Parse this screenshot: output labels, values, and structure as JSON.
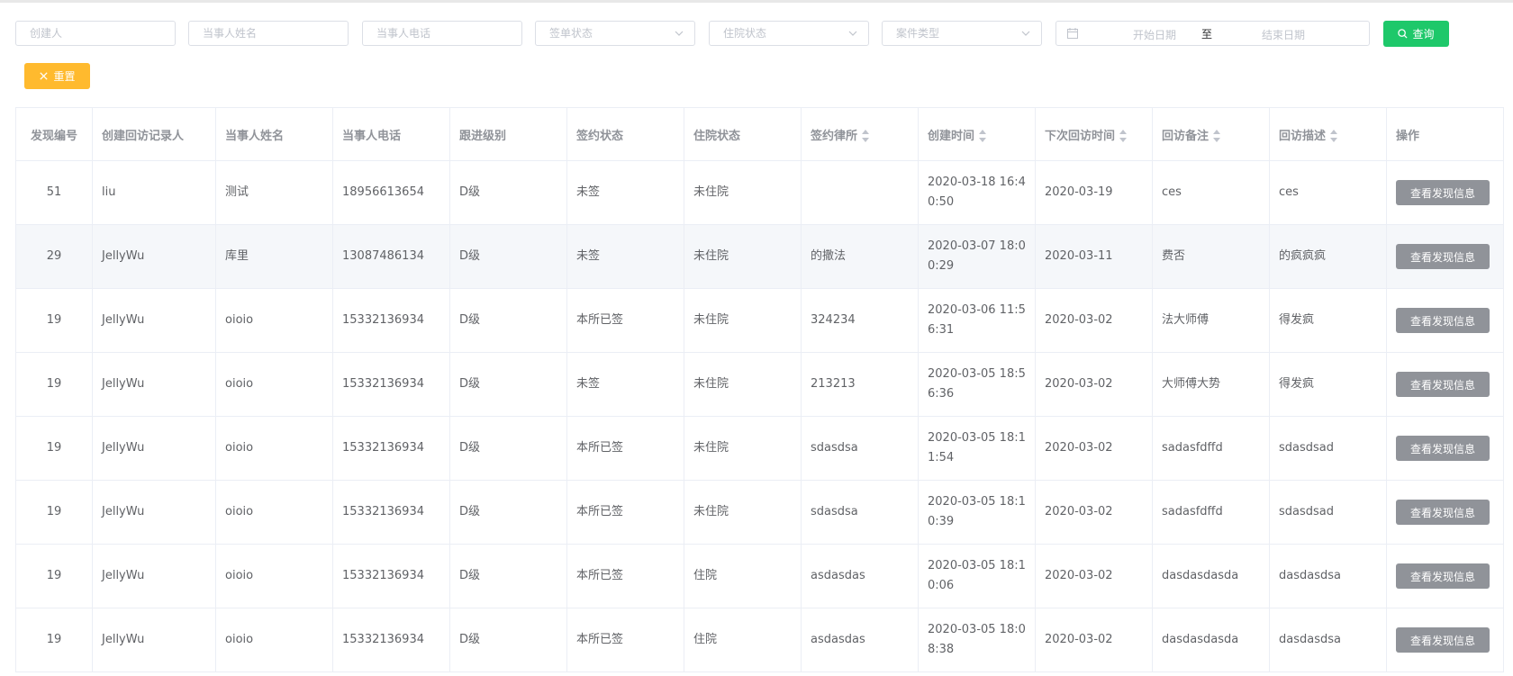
{
  "filters": {
    "creator_placeholder": "创建人",
    "party_name_placeholder": "当事人姓名",
    "party_phone_placeholder": "当事人电话",
    "sign_status_placeholder": "签单状态",
    "hospital_status_placeholder": "住院状态",
    "case_type_placeholder": "案件类型",
    "start_date_placeholder": "开始日期",
    "date_separator": "至",
    "end_date_placeholder": "结束日期",
    "query_label": "查询",
    "reset_label": "重置"
  },
  "table": {
    "headers": [
      "发现编号",
      "创建回访记录人",
      "当事人姓名",
      "当事人电话",
      "跟进级别",
      "签约状态",
      "住院状态",
      "签约律所",
      "创建时间",
      "下次回访时间",
      "回访备注",
      "回访描述",
      "操作"
    ],
    "action_label": "查看发现信息",
    "rows": [
      [
        "51",
        "liu",
        "测试",
        "18956613654",
        "D级",
        "未签",
        "未住院",
        "",
        "2020-03-18 16:40:50",
        "2020-03-19",
        "ces",
        "ces"
      ],
      [
        "29",
        "JellyWu",
        "库里",
        "13087486134",
        "D级",
        "未签",
        "未住院",
        "的撒法",
        "2020-03-07 18:00:29",
        "2020-03-11",
        "费否",
        "的疯疯疯"
      ],
      [
        "19",
        "JellyWu",
        "oioio",
        "15332136934",
        "D级",
        "本所已签",
        "未住院",
        "324234",
        "2020-03-06 11:56:31",
        "2020-03-02",
        "法大师傅",
        "得发疯"
      ],
      [
        "19",
        "JellyWu",
        "oioio",
        "15332136934",
        "D级",
        "未签",
        "未住院",
        "213213",
        "2020-03-05 18:56:36",
        "2020-03-02",
        "大师傅大势",
        "得发疯"
      ],
      [
        "19",
        "JellyWu",
        "oioio",
        "15332136934",
        "D级",
        "本所已签",
        "未住院",
        "sdasdsa",
        "2020-03-05 18:11:54",
        "2020-03-02",
        "sadasfdffd",
        "sdasdsad"
      ],
      [
        "19",
        "JellyWu",
        "oioio",
        "15332136934",
        "D级",
        "本所已签",
        "未住院",
        "sdasdsa",
        "2020-03-05 18:10:39",
        "2020-03-02",
        "sadasfdffd",
        "sdasdsad"
      ],
      [
        "19",
        "JellyWu",
        "oioio",
        "15332136934",
        "D级",
        "本所已签",
        "住院",
        "asdasdas",
        "2020-03-05 18:10:06",
        "2020-03-02",
        "dasdasdasda",
        "dasdasdsa"
      ],
      [
        "19",
        "JellyWu",
        "oioio",
        "15332136934",
        "D级",
        "本所已签",
        "住院",
        "asdasdas",
        "2020-03-05 18:08:38",
        "2020-03-02",
        "dasdasdasda",
        "dasdasdsa"
      ]
    ]
  },
  "colors": {
    "query_button": "#1ec86a",
    "reset_button": "#ffba2e",
    "action_button": "#909399"
  }
}
